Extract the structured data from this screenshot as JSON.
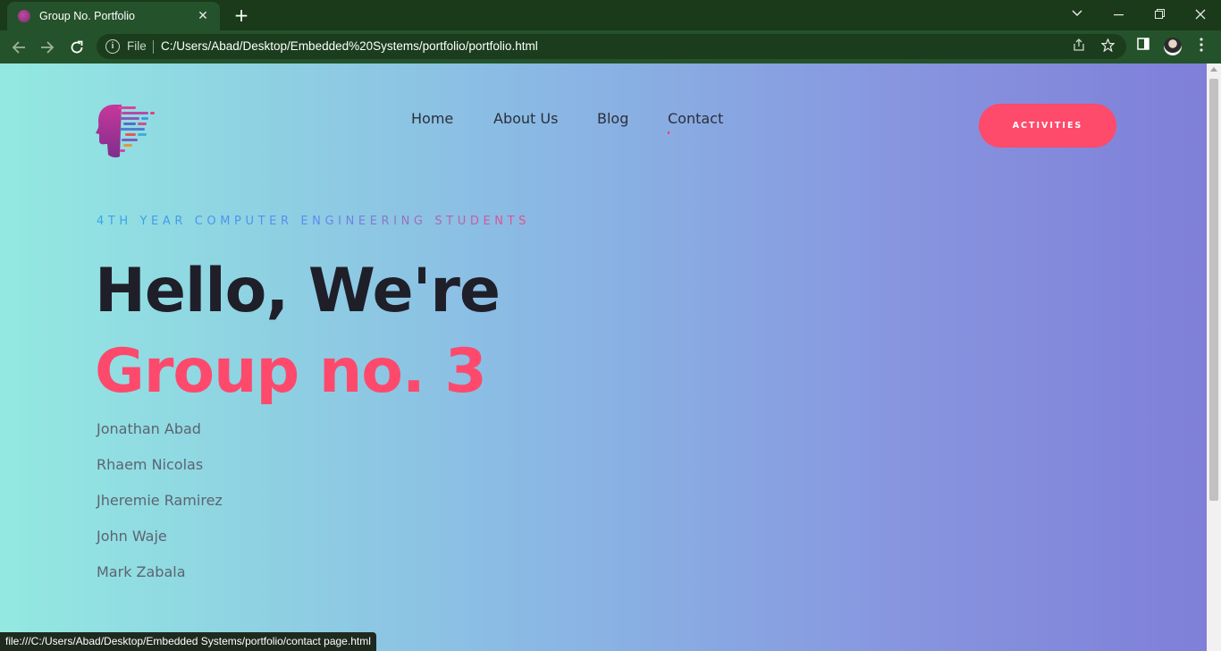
{
  "browser": {
    "tab_title": "Group No. Portfolio",
    "tab_close": "✕",
    "new_tab": "+",
    "omnibox_security_label": "File",
    "url": "C:/Users/Abad/Desktop/Embedded%20Systems/portfolio/portfolio.html",
    "status_url": "file:///C:/Users/Abad/Desktop/Embedded Systems/portfolio/contact page.html"
  },
  "page": {
    "nav": {
      "items": [
        {
          "label": "Home"
        },
        {
          "label": "About Us"
        },
        {
          "label": "Blog"
        },
        {
          "label": "Contact"
        }
      ]
    },
    "cta_label": "ACTIVITIES",
    "eyebrow": "4TH YEAR COMPUTER ENGINEERING STUDENTS",
    "hero": {
      "line1": "Hello, We're",
      "line2": "Group no. 3"
    },
    "members": [
      "Jonathan Abad",
      "Rhaem Nicolas",
      "Jheremie Ramirez",
      "John Waje",
      "Mark Zabala"
    ]
  },
  "colors": {
    "accent": "#fd4a6c",
    "heading": "#1f1f29",
    "body_text": "#5c6470",
    "chrome_dark": "#1a3a19",
    "chrome_toolbar": "#24522a"
  },
  "icons": {
    "tab_favicon": "logo-icon",
    "back": "back-arrow-icon",
    "forward": "forward-arrow-icon",
    "reload": "reload-icon",
    "info": "info-icon",
    "share": "share-icon",
    "bookmark": "star-icon",
    "side_panel": "side-panel-icon",
    "profile": "avatar",
    "menu": "kebab-menu-icon",
    "tab_search": "chevron-down-icon",
    "minimize": "minimize-icon",
    "restore": "restore-icon",
    "close": "close-icon"
  }
}
